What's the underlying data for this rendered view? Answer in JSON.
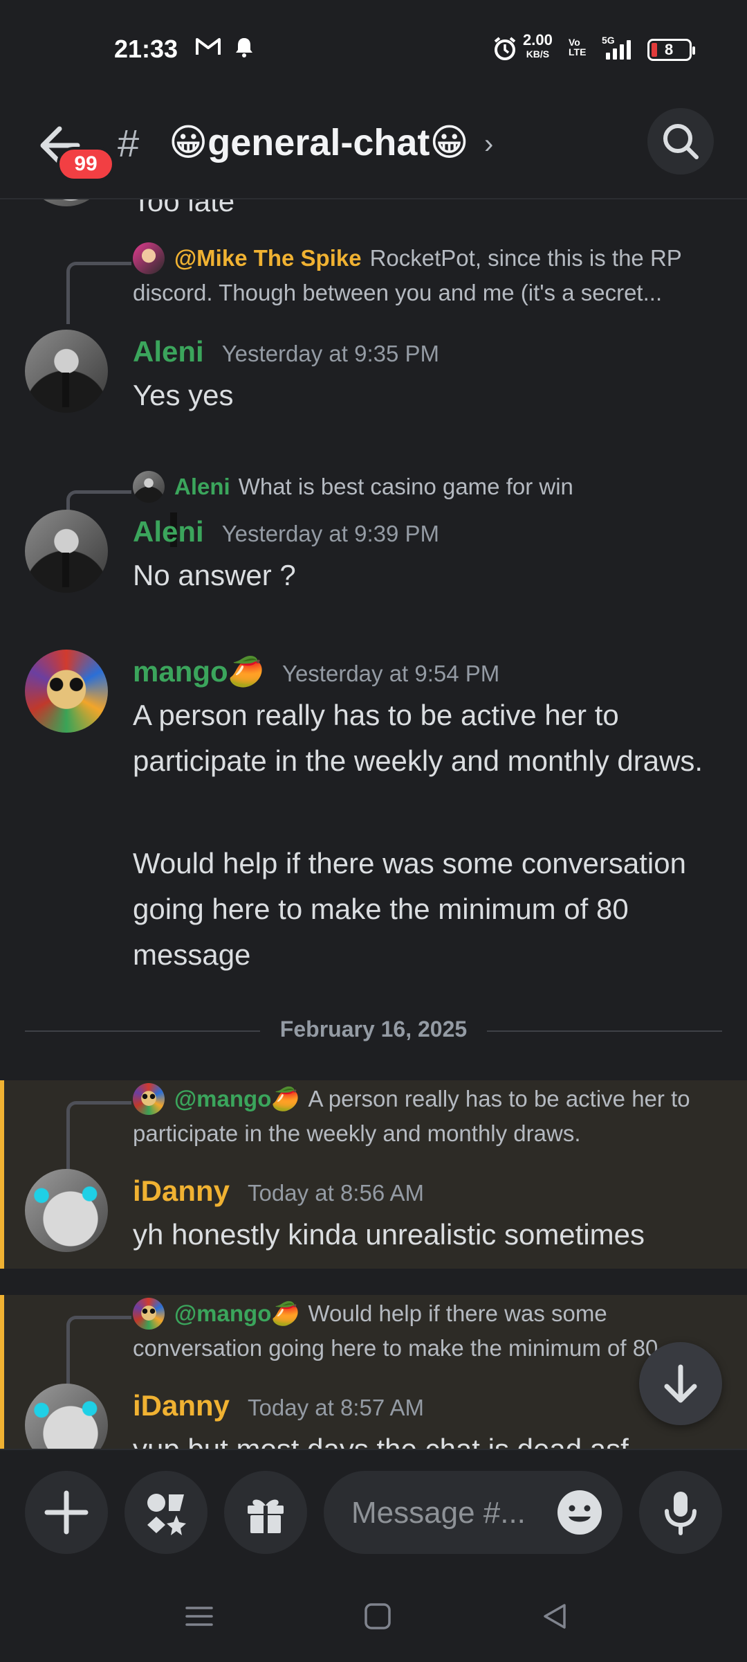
{
  "status_bar": {
    "time": "21:33",
    "speed_value": "2.00",
    "speed_unit": "KB/S",
    "volte": "Vo LTE",
    "network": "5G",
    "battery": "8"
  },
  "header": {
    "badge_count": "99",
    "hash": "#",
    "channel_name": "😀general-chat😀",
    "chevron": "›"
  },
  "messages": [
    {
      "id": "m1",
      "reply": {
        "author": "@Mike The Spike",
        "text": "RocketPot, since this is the RP discord. Though between you and me (it's a secret..."
      },
      "author": "Aleni",
      "time": "Yesterday at 9:35 PM",
      "body": [
        "Yes yes"
      ]
    },
    {
      "id": "m2",
      "reply": {
        "author": "Aleni",
        "text": "What is best casino game for win"
      },
      "author": "Aleni",
      "time": "Yesterday at 9:39 PM",
      "body": [
        "No answer ?"
      ]
    },
    {
      "id": "m3",
      "author": "mango🥭",
      "time": "Yesterday at 9:54 PM",
      "body": [
        "A person really has to be active her to participate in the weekly and monthly draws.",
        "Would help if there was some conversation going here to make the minimum of 80 message"
      ]
    },
    {
      "id": "m4",
      "reply": {
        "author": "@mango🥭",
        "text": "A person really has to be active her to participate in the weekly and monthly draws."
      },
      "author": "iDanny",
      "time": "Today at 8:56 AM",
      "body": [
        "yh honestly kinda unrealistic sometimes"
      ]
    },
    {
      "id": "m5",
      "reply": {
        "author": "@mango🥭",
        "text": "Would help if there was some conversation going here to make the minimum of 80"
      },
      "author": "iDanny",
      "time": "Today at 8:57 AM",
      "body": [
        "yup but most days the chat is dead asf"
      ]
    }
  ],
  "partial_top_text": "Too late",
  "date_divider": "February 16, 2025",
  "composer": {
    "placeholder": "Message #..."
  },
  "colors": {
    "background": "#1e1f22",
    "aleni_green": "#3ba55c",
    "idanny_yellow": "#f0b232",
    "highlight_bg": "#2d2b26",
    "badge_red": "#f23f43"
  },
  "icons": {
    "back": "arrow-left-icon",
    "search": "search-icon",
    "add": "plus-icon",
    "apps": "apps-icon",
    "gift": "gift-icon",
    "emoji": "emoji-icon",
    "mic": "microphone-icon",
    "jump": "arrow-down-icon"
  }
}
